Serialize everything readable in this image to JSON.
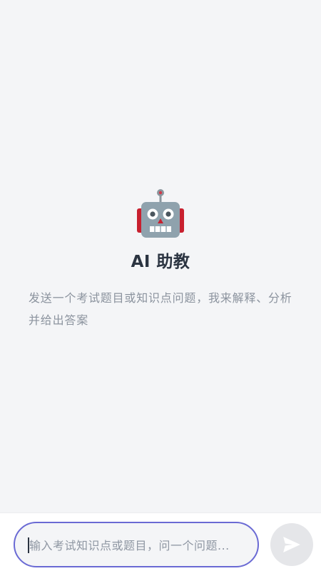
{
  "empty_state": {
    "icon": "robot-icon",
    "title": "AI 助教",
    "description": "发送一个考试题目或知识点问题，我来解释、分析并给出答案"
  },
  "composer": {
    "placeholder": "输入考试知识点或题目，问一个问题...",
    "value": "",
    "send_icon": "send-icon"
  },
  "colors": {
    "background": "#f4f5f7",
    "input_border": "#6a6ad4",
    "send_button_disabled": "#e5e6e9",
    "robot_body": "#8fa2ad",
    "robot_ears": "#c8202f"
  }
}
